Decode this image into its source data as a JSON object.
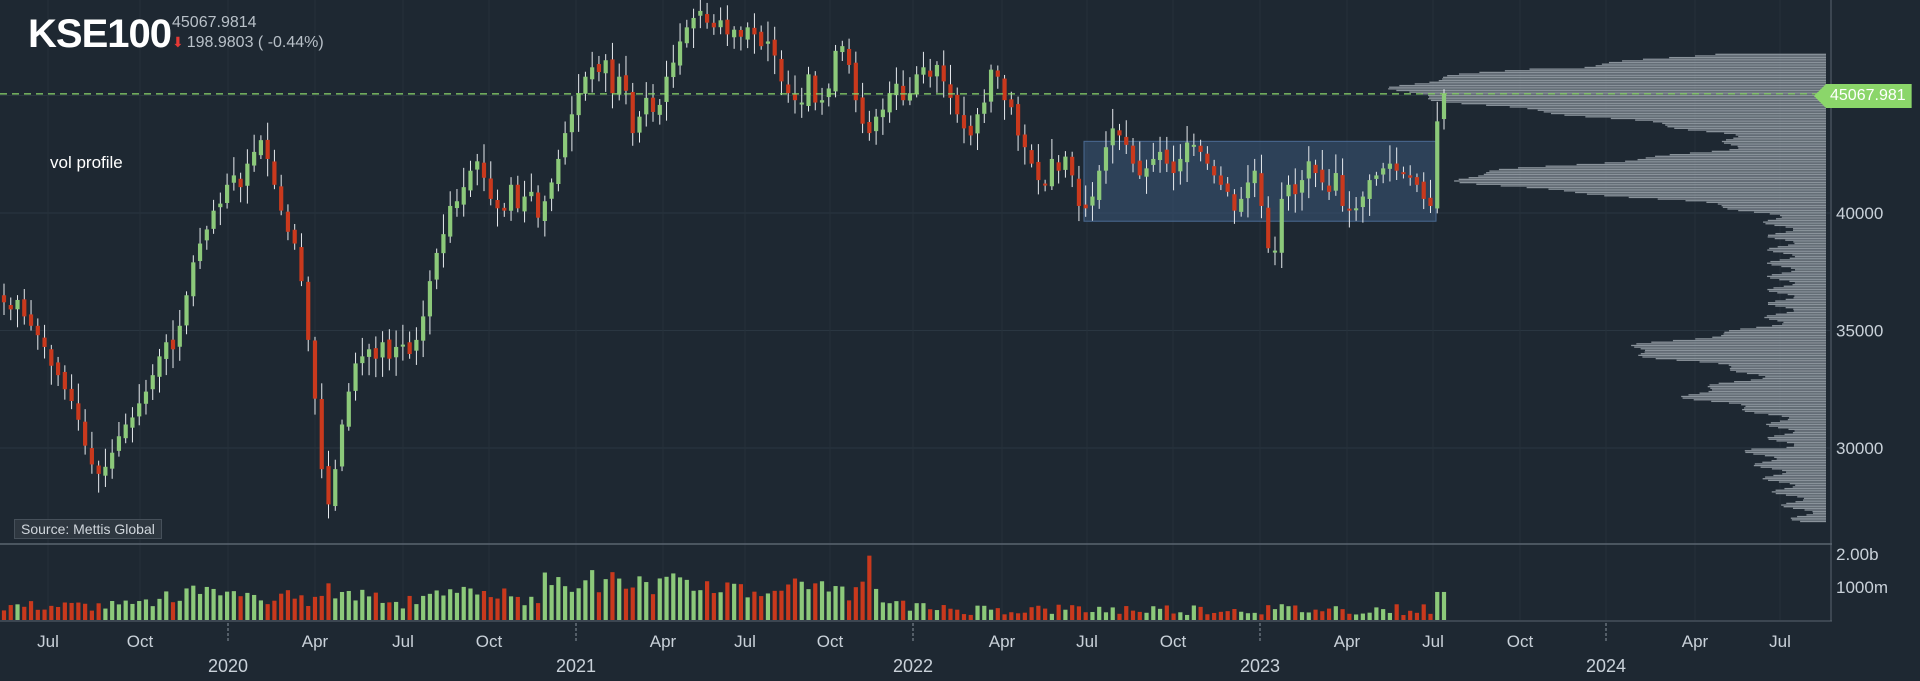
{
  "header": {
    "ticker": "KSE100",
    "last_price": "45067.9814",
    "change_text": "198.9803 ( -0.44%)"
  },
  "annotation_text": "vol profile",
  "source_text": "Source: Mettis Global",
  "last_price_tag": "45067.981",
  "colors": {
    "up": "#8cc97a",
    "down": "#c9391d",
    "background": "#1e2832",
    "profile": "#9ea6ae",
    "range_box": "#3b5578"
  },
  "chart_data": {
    "type": "candlestick",
    "title": "KSE100",
    "price_axis": {
      "ticks": [
        30000,
        35000,
        40000
      ],
      "labels": [
        "30000",
        "35000",
        "40000"
      ],
      "range": [
        26800,
        46850
      ]
    },
    "volume_axis": {
      "ticks": [
        1000000000,
        2000000000
      ],
      "labels": [
        "1000m",
        "2.00b"
      ]
    },
    "time_axis": {
      "month_labels": [
        "Jul",
        "Oct",
        "Apr",
        "Jul",
        "Oct",
        "Apr",
        "Jul",
        "Oct",
        "Apr",
        "Jul",
        "Oct",
        "Apr",
        "Jul",
        "Oct",
        "Apr",
        "Jul"
      ],
      "year_labels": [
        "2020",
        "2021",
        "2022",
        "2023",
        "2024"
      ]
    },
    "volume_profile": true,
    "range_box": {
      "from": "2022-07",
      "to": "2023-07",
      "low": 39650,
      "high": 43050
    },
    "last_price": 45067.98,
    "weekly_closes_approx": [
      36200,
      35900,
      36300,
      35600,
      35200,
      34800,
      34300,
      33500,
      33100,
      32500,
      32000,
      31200,
      30100,
      29300,
      28900,
      29200,
      29800,
      30500,
      31000,
      31300,
      31900,
      32400,
      33100,
      33900,
      34500,
      34200,
      35200,
      36500,
      37900,
      38700,
      39300,
      40100,
      40400,
      41200,
      41600,
      41100,
      42100,
      42600,
      43100,
      42300,
      41200,
      40100,
      39200,
      38700,
      37100,
      34600,
      32100,
      29100,
      27600,
      29100,
      31000,
      32400,
      33600,
      33900,
      34200,
      33800,
      34500,
      33800,
      34300,
      34400,
      34000,
      34600,
      35600,
      37100,
      38300,
      39100,
      40300,
      40500,
      41100,
      41800,
      42200,
      41500,
      40600,
      40200,
      40100,
      41200,
      40200,
      40700,
      40900,
      39800,
      40500,
      41300,
      42300,
      43400,
      44200,
      45100,
      45800,
      46200,
      46000,
      46500,
      45100,
      45800,
      45200,
      43400,
      44100,
      44900,
      44300,
      44600,
      45800,
      46400,
      47300,
      47900,
      48300,
      48600,
      48100,
      47900,
      48200,
      47600,
      47800,
      47500,
      47900,
      47600,
      47100,
      47300,
      46700,
      45600,
      45100,
      44800,
      44700,
      45900,
      44700,
      44800,
      45300,
      46900,
      47100,
      46300,
      44800,
      43800,
      43400,
      44100,
      44400,
      45100,
      45500,
      44800,
      45100,
      45900,
      46200,
      45800,
      46300,
      45600,
      44900,
      44200,
      43600,
      43300,
      44200,
      44700,
      46100,
      45800,
      44800,
      44500,
      43300,
      42800,
      42100,
      41400,
      41200,
      42300,
      41800,
      42400,
      41600,
      40300,
      40200,
      40700,
      41800,
      42800,
      43600,
      43300,
      42900,
      42100,
      41600,
      41900,
      42300,
      42600,
      42100,
      41700,
      42300,
      43000,
      42900,
      42600,
      42100,
      41600,
      41200,
      40900,
      40100,
      40600,
      41300,
      41800,
      40300,
      38500,
      38400,
      40600,
      41200,
      40800,
      41400,
      42200,
      41700,
      41300,
      40900,
      41700,
      40300,
      40100,
      40200,
      40700,
      41400,
      41600,
      41900,
      42100,
      41800,
      41700,
      41500,
      41200,
      40600,
      40300,
      43900,
      45068
    ],
    "volume_profile_peak_price": 45300
  }
}
